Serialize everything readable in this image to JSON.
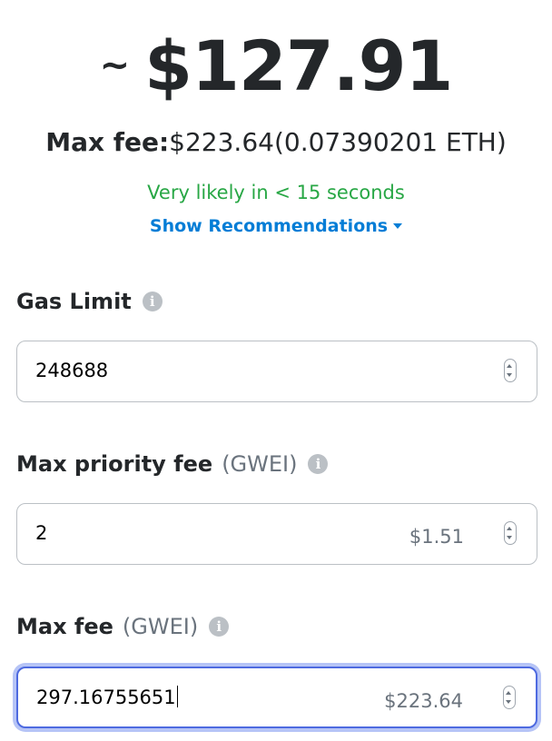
{
  "summary": {
    "tilde": "~",
    "estimated_fee": "$127.91",
    "max_fee_label": "Max fee:",
    "max_fee_fiat": "$223.64",
    "max_fee_eth": "(0.07390201 ETH)",
    "likelihood": "Very likely in < 15 seconds",
    "recommendations_link": "Show Recommendations"
  },
  "fields": {
    "gas_limit": {
      "label": "Gas Limit",
      "value": "248688"
    },
    "max_priority_fee": {
      "label": "Max priority fee",
      "unit": "(GWEI)",
      "value": "2",
      "fiat": "$1.51"
    },
    "max_fee": {
      "label": "Max fee",
      "unit": "(GWEI)",
      "value": "297.16755651",
      "fiat": "$223.64"
    }
  },
  "icons": {
    "info": "i"
  },
  "colors": {
    "success": "#28a745",
    "link": "#037dd6",
    "focus_border": "#4e6ae0",
    "text": "#24272a",
    "muted": "#6a737d"
  }
}
